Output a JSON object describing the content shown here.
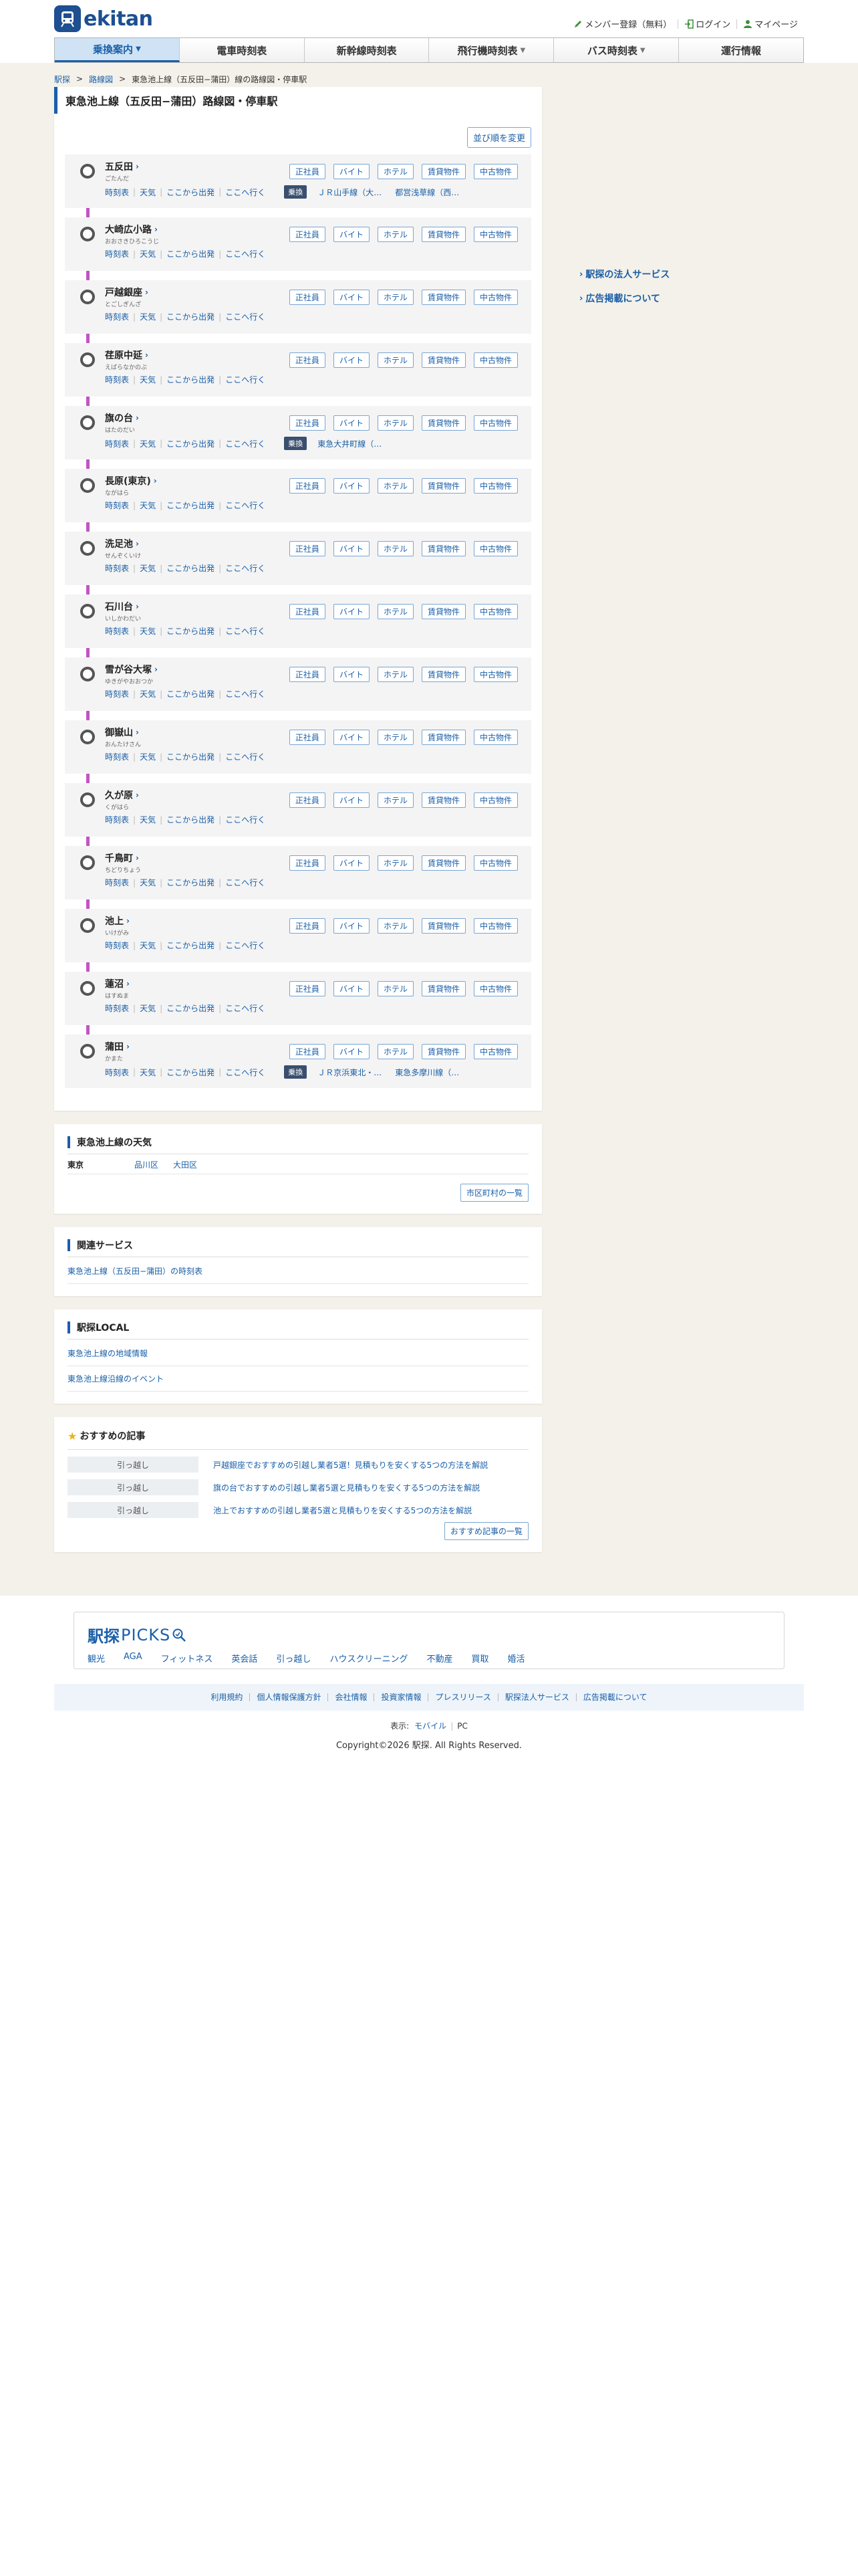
{
  "header": {
    "logo_text": "ekitan",
    "links": [
      "メンバー登録（無料）",
      "ログイン",
      "マイページ"
    ]
  },
  "gnav": [
    {
      "label": "乗換案内",
      "dropdown": true,
      "active": true
    },
    {
      "label": "電車時刻表",
      "dropdown": false,
      "active": false
    },
    {
      "label": "新幹線時刻表",
      "dropdown": false,
      "active": false
    },
    {
      "label": "飛行機時刻表",
      "dropdown": true,
      "active": false
    },
    {
      "label": "バス時刻表",
      "dropdown": true,
      "active": false
    },
    {
      "label": "運行情報",
      "dropdown": false,
      "active": false
    }
  ],
  "breadcrumb": [
    "駅探",
    "路線図",
    "東急池上線（五反田−蒲田）線の路線図・停車駅"
  ],
  "page_title": "東急池上線（五反田−蒲田）路線図・停車駅",
  "sort_button": "並び順を変更",
  "station_links": [
    "時刻表",
    "天気",
    "ここから出発",
    "ここへ行く"
  ],
  "station_buttons": [
    "正社員",
    "バイト",
    "ホテル",
    "賃貸物件",
    "中古物件"
  ],
  "transfer_badge": "乗換",
  "stations": [
    {
      "name": "五反田",
      "kana": "ごたんだ",
      "transfers": [
        "ＪＲ山手線（大…",
        "都営浅草線（西…"
      ]
    },
    {
      "name": "大崎広小路",
      "kana": "おおさきひろこうじ",
      "transfers": []
    },
    {
      "name": "戸越銀座",
      "kana": "とごしぎんざ",
      "transfers": []
    },
    {
      "name": "荏原中延",
      "kana": "えばらなかのぶ",
      "transfers": []
    },
    {
      "name": "旗の台",
      "kana": "はたのだい",
      "transfers": [
        "東急大井町線（…"
      ]
    },
    {
      "name": "長原(東京)",
      "kana": "ながはら",
      "transfers": []
    },
    {
      "name": "洗足池",
      "kana": "せんぞくいけ",
      "transfers": []
    },
    {
      "name": "石川台",
      "kana": "いしかわだい",
      "transfers": []
    },
    {
      "name": "雪が谷大塚",
      "kana": "ゆきがやおおつか",
      "transfers": []
    },
    {
      "name": "御嶽山",
      "kana": "おんたけさん",
      "transfers": []
    },
    {
      "name": "久が原",
      "kana": "くがはら",
      "transfers": []
    },
    {
      "name": "千鳥町",
      "kana": "ちどりちょう",
      "transfers": []
    },
    {
      "name": "池上",
      "kana": "いけがみ",
      "transfers": []
    },
    {
      "name": "蓮沼",
      "kana": "はすぬま",
      "transfers": []
    },
    {
      "name": "蒲田",
      "kana": "かまた",
      "transfers": [
        "ＪＲ京浜東北・…",
        "東急多摩川線（…"
      ]
    }
  ],
  "weather": {
    "title": "東急池上線の天気",
    "pref": "東京",
    "cities": [
      "品川区",
      "大田区"
    ],
    "more_button": "市区町村の一覧"
  },
  "related": {
    "title": "関連サービス",
    "links": [
      "東急池上線（五反田−蒲田）の時刻表"
    ]
  },
  "local": {
    "title": "駅探LOCAL",
    "links": [
      "東急池上線の地域情報",
      "東急池上線沿線のイベント"
    ]
  },
  "recommended": {
    "title": "おすすめの記事",
    "items": [
      {
        "category": "引っ越し",
        "text": "戸越銀座でおすすめの引越し業者5選！見積もりを安くする5つの方法を解説"
      },
      {
        "category": "引っ越し",
        "text": "旗の台でおすすめの引越し業者5選と見積もりを安くする5つの方法を解説"
      },
      {
        "category": "引っ越し",
        "text": "池上でおすすめの引越し業者5選と見積もりを安くする5つの方法を解説"
      }
    ],
    "more_button": "おすすめ記事の一覧"
  },
  "sidebar": {
    "links": [
      "駅探の法人サービス",
      "広告掲載について"
    ]
  },
  "picks": {
    "logo_main": "駅探",
    "logo_sub": "PICKS",
    "tags": [
      "観光",
      "AGA",
      "フィットネス",
      "英会話",
      "引っ越し",
      "ハウスクリーニング",
      "不動産",
      "買取",
      "婚活"
    ]
  },
  "footer": {
    "links": [
      "利用規約",
      "個人情報保護方針",
      "会社情報",
      "投資家情報",
      "プレスリリース",
      "駅探法人サービス",
      "広告掲載について"
    ],
    "display_label": "表示:",
    "display_mobile": "モバイル",
    "display_pc": "PC",
    "copyright": "Copyright©2026 駅探. All Rights Reserved."
  },
  "colors": {
    "accent": "#1a5fa8",
    "line_color": "#c155c2",
    "band_bg": "#f4f1ea"
  }
}
